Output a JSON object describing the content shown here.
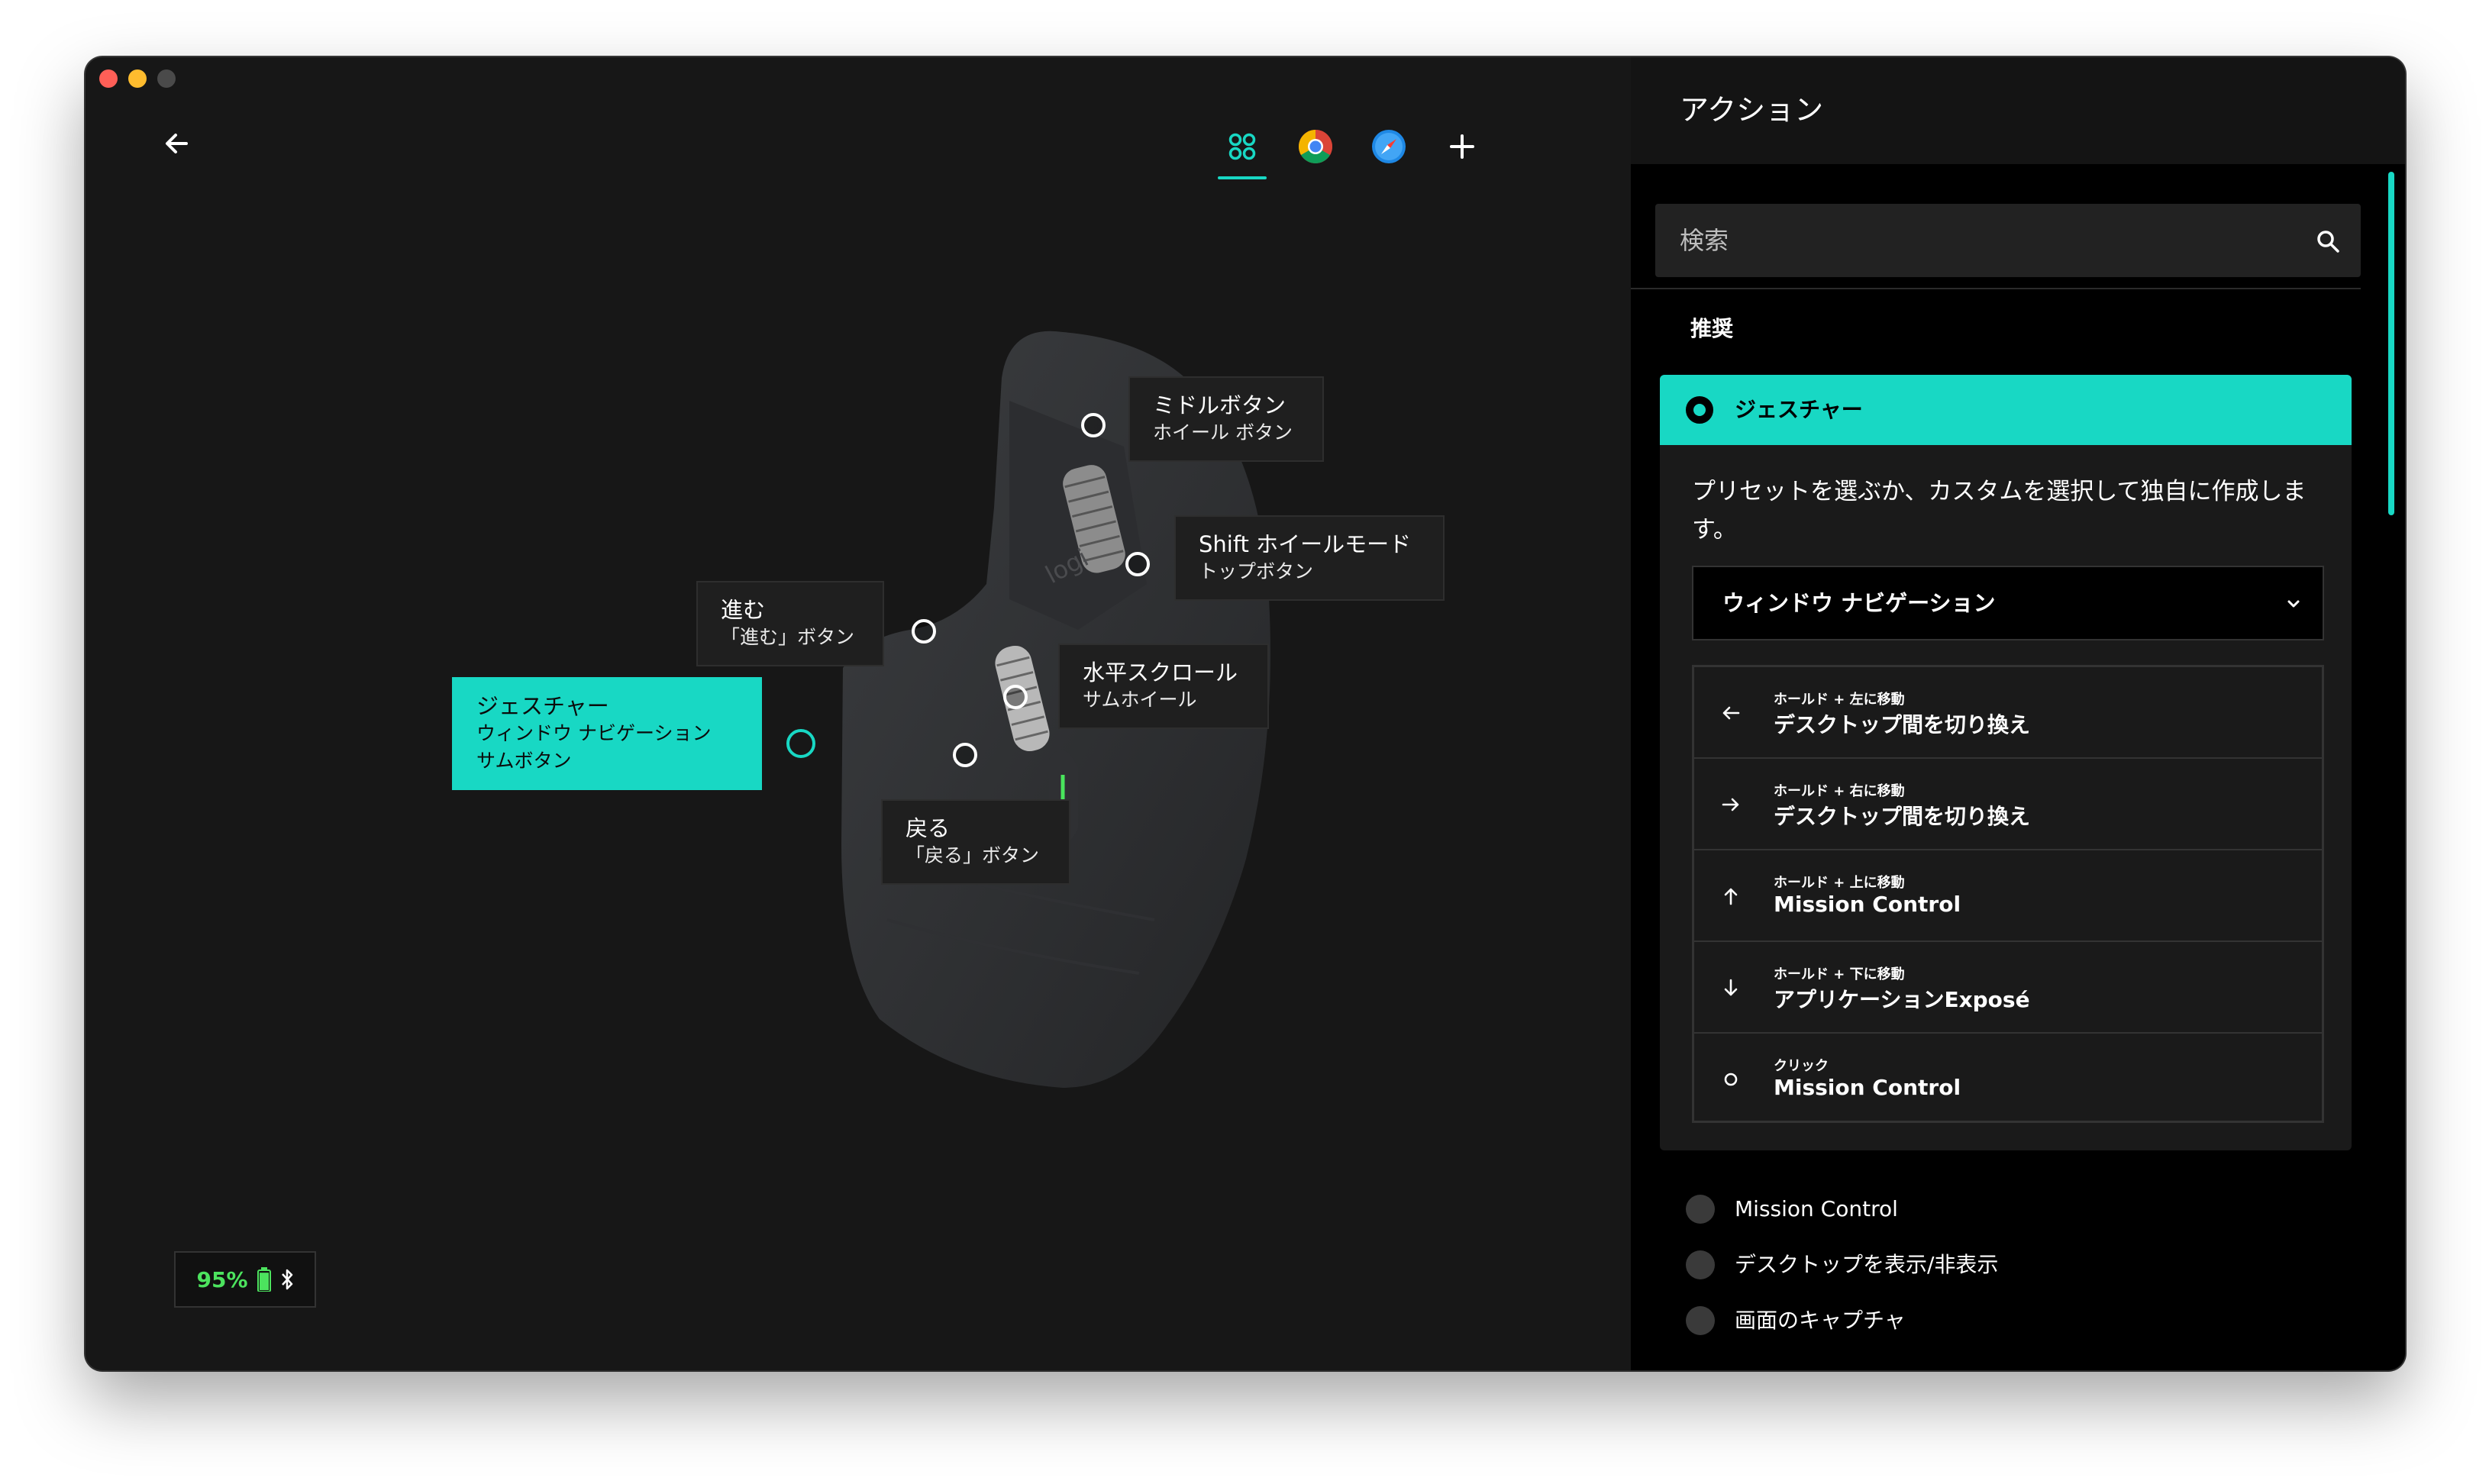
{
  "header": {
    "app_tabs": [
      {
        "icon": "all-apps-icon",
        "active": true
      },
      {
        "icon": "chrome-icon",
        "active": false
      },
      {
        "icon": "safari-icon",
        "active": false
      },
      {
        "icon": "add-icon",
        "active": false
      }
    ]
  },
  "device": {
    "callouts": {
      "middle": {
        "title": "ミドルボタン",
        "subtitle": "ホイール ボタン"
      },
      "shift": {
        "title": "Shift ホイールモード",
        "subtitle": "トップボタン"
      },
      "forward": {
        "title": "進む",
        "subtitle": "「進む」ボタン"
      },
      "hscroll": {
        "title": "水平スクロール",
        "subtitle": "サムホイール"
      },
      "gesture": {
        "title": "ジェスチャー",
        "subtitle": "ウィンドウ ナビゲーション",
        "subtitle2": "サムボタン"
      },
      "back": {
        "title": "戻る",
        "subtitle": "「戻る」ボタン"
      }
    },
    "battery": {
      "percent": "95%",
      "level": 0.95,
      "color": "#4ce35e"
    }
  },
  "panel": {
    "title": "アクション",
    "search": {
      "placeholder": "検索"
    },
    "section_label": "推奨",
    "selected_card": {
      "title": "ジェスチャー",
      "description": "プリセットを選ぶか、カスタムを選択して独自に作成します。",
      "dropdown_value": "ウィンドウ ナビゲーション",
      "gestures": [
        {
          "icon": "arrow-left-icon",
          "sub": "ホールド + 左に移動",
          "main": "デスクトップ間を切り換え"
        },
        {
          "icon": "arrow-right-icon",
          "sub": "ホールド + 右に移動",
          "main": "デスクトップ間を切り換え"
        },
        {
          "icon": "arrow-up-icon",
          "sub": "ホールド + 上に移動",
          "main": "Mission Control"
        },
        {
          "icon": "arrow-down-icon",
          "sub": "ホールド + 下に移動",
          "main": "アプリケーションExposé"
        },
        {
          "icon": "click-icon",
          "sub": "クリック",
          "main": "Mission Control"
        }
      ]
    },
    "options": [
      {
        "label": "Mission Control"
      },
      {
        "label": "デスクトップを表示/非表示"
      },
      {
        "label": "画面のキャプチャ"
      }
    ]
  },
  "colors": {
    "accent": "#18d8c4",
    "background": "#171717",
    "panel": "#000000"
  }
}
